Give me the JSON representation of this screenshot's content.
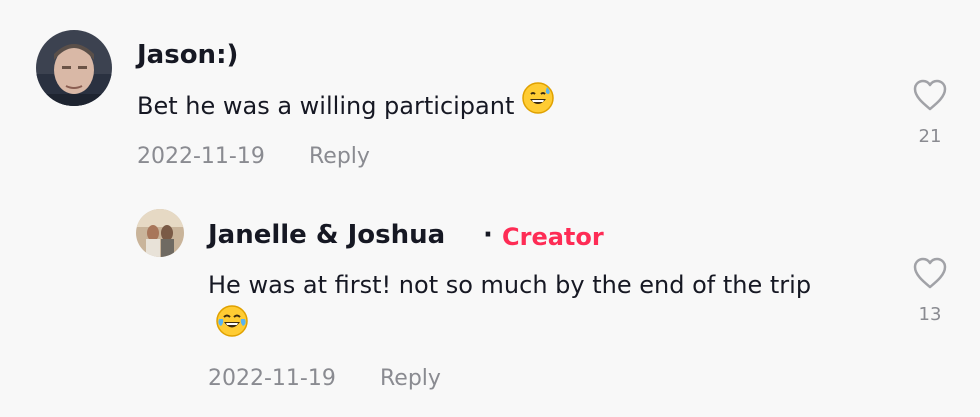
{
  "comments": [
    {
      "author": "Jason:)",
      "text": "Bet he was a willing participant",
      "emoji": "sweat-smile-emoji",
      "date": "2022-11-19",
      "reply_label": "Reply",
      "likes": "21"
    }
  ],
  "replies": [
    {
      "author": "Janelle & Joshua",
      "separator": "·",
      "badge": "Creator",
      "text": "He was at first! not so much by the end of the trip",
      "emoji": "tears-of-joy-emoji",
      "date": "2022-11-19",
      "reply_label": "Reply",
      "likes": "13"
    }
  ],
  "colors": {
    "background": "#f8f8f8",
    "text": "#161823",
    "muted": "#8a8b91",
    "creator_badge": "#fe2c55"
  }
}
